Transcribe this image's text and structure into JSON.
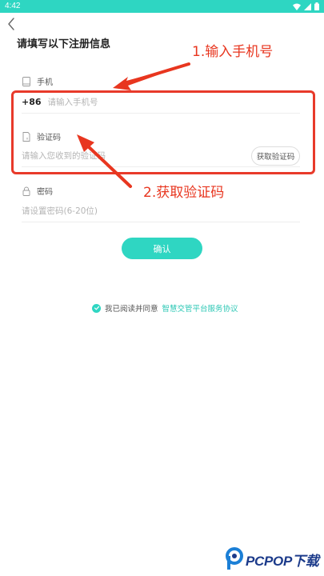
{
  "status_bar": {
    "time": "4:42",
    "bg_color": "#2ed6c2",
    "icons": [
      "wifi-icon",
      "signal-icon",
      "battery-icon"
    ]
  },
  "header": {
    "back_icon": "chevron-left-icon",
    "title": "请填写以下注册信息"
  },
  "form": {
    "phone": {
      "label": "手机",
      "icon": "phone-icon",
      "country_code": "+86",
      "placeholder": "请输入手机号",
      "value": ""
    },
    "code": {
      "label": "验证码",
      "icon": "document-icon",
      "placeholder": "请输入您收到的验证码",
      "value": "",
      "send_button": "获取验证码"
    },
    "password": {
      "label": "密码",
      "icon": "lock-icon",
      "placeholder": "请设置密码(6-20位)",
      "value": ""
    }
  },
  "confirm_button": "确认",
  "agreement": {
    "checked": true,
    "prefix": "我已阅读并同意",
    "link": "智慧交管平台服务协议"
  },
  "annotations": {
    "step1": "1.输入手机号",
    "step2": "2.获取验证码",
    "color": "#e8361f"
  },
  "watermark": {
    "brand": "PCPOP下载"
  },
  "colors": {
    "accent": "#2fd6c2",
    "link": "#2fc8b6"
  }
}
